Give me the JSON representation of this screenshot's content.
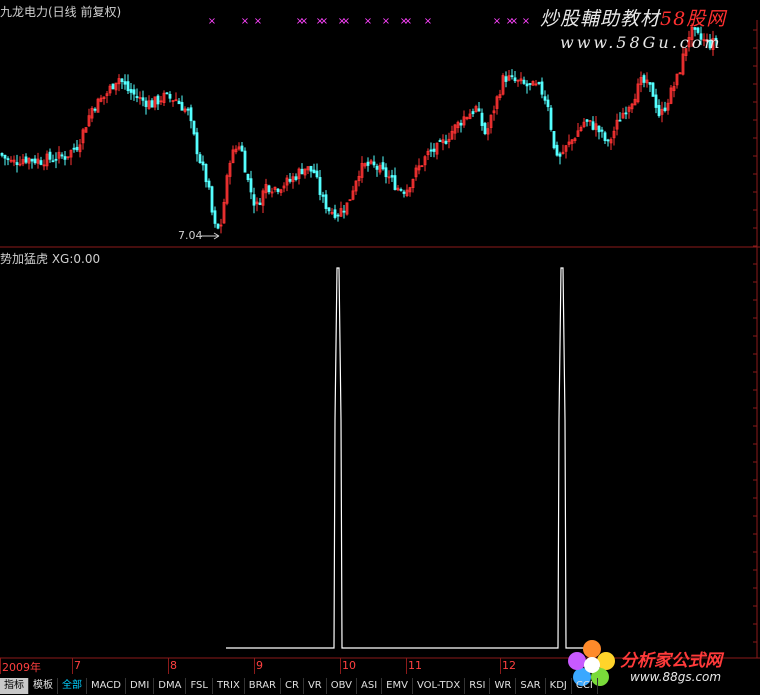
{
  "header": {
    "top_title": "九龙电力(日线 前复权)",
    "sub_title": "势加猛虎 XG:0.00",
    "low_label": "7.04"
  },
  "watermarks": {
    "line1_a": "炒股輔助教材",
    "line1_b": "58股网",
    "line2": "www.58Gu.com",
    "line3": "分析家公式网",
    "line4": "www.88gs.com"
  },
  "date_axis": [
    "2009年",
    "7",
    "8",
    "9",
    "10",
    "11",
    "12"
  ],
  "tabs": [
    {
      "label": "指标",
      "state": "selected"
    },
    {
      "label": "模板",
      "state": "normal"
    },
    {
      "label": "全部",
      "state": "active"
    },
    {
      "label": "MACD",
      "state": "normal"
    },
    {
      "label": "DMI",
      "state": "normal"
    },
    {
      "label": "DMA",
      "state": "normal"
    },
    {
      "label": "FSL",
      "state": "normal"
    },
    {
      "label": "TRIX",
      "state": "normal"
    },
    {
      "label": "BRAR",
      "state": "normal"
    },
    {
      "label": "CR",
      "state": "normal"
    },
    {
      "label": "VR",
      "state": "normal"
    },
    {
      "label": "OBV",
      "state": "normal"
    },
    {
      "label": "ASI",
      "state": "normal"
    },
    {
      "label": "EMV",
      "state": "normal"
    },
    {
      "label": "VOL-TDX",
      "state": "normal"
    },
    {
      "label": "RSI",
      "state": "normal"
    },
    {
      "label": "WR",
      "state": "normal"
    },
    {
      "label": "SAR",
      "state": "normal"
    },
    {
      "label": "KDJ",
      "state": "normal"
    },
    {
      "label": "CCI",
      "state": "normal"
    }
  ],
  "colors": {
    "up": "#ff3333",
    "down": "#54ffff",
    "signal_line": "#ffffff",
    "marker": "#ff44ff",
    "separator": "#8b1a1a",
    "axis_text": "#ff4040"
  },
  "chart_data": {
    "type": "candlestick",
    "title": "九龙电力(日线 前复权)",
    "annotations": [
      {
        "text": "7.04",
        "type": "period-low"
      }
    ],
    "price_path": [
      [
        0,
        8.9
      ],
      [
        12,
        8.7
      ],
      [
        24,
        8.8
      ],
      [
        40,
        8.75
      ],
      [
        52,
        8.8
      ],
      [
        66,
        8.85
      ],
      [
        78,
        9.1
      ],
      [
        92,
        9.9
      ],
      [
        106,
        10.2
      ],
      [
        118,
        10.6
      ],
      [
        128,
        10.3
      ],
      [
        140,
        10.1
      ],
      [
        152,
        10.0
      ],
      [
        164,
        10.15
      ],
      [
        176,
        10.1
      ],
      [
        188,
        9.8
      ],
      [
        198,
        8.9
      ],
      [
        208,
        8.2
      ],
      [
        214,
        7.3
      ],
      [
        220,
        7.2
      ],
      [
        230,
        8.8
      ],
      [
        240,
        9.15
      ],
      [
        248,
        8.3
      ],
      [
        256,
        7.7
      ],
      [
        266,
        8.2
      ],
      [
        276,
        8.15
      ],
      [
        290,
        8.3
      ],
      [
        304,
        8.6
      ],
      [
        314,
        8.5
      ],
      [
        322,
        7.9
      ],
      [
        330,
        7.65
      ],
      [
        338,
        7.6
      ],
      [
        348,
        7.8
      ],
      [
        358,
        8.5
      ],
      [
        366,
        8.65
      ],
      [
        376,
        8.6
      ],
      [
        388,
        8.4
      ],
      [
        398,
        8.15
      ],
      [
        406,
        8.1
      ],
      [
        416,
        8.5
      ],
      [
        428,
        8.9
      ],
      [
        440,
        9.05
      ],
      [
        452,
        9.4
      ],
      [
        464,
        9.7
      ],
      [
        476,
        9.9
      ],
      [
        486,
        9.3
      ],
      [
        494,
        9.9
      ],
      [
        504,
        10.6
      ],
      [
        514,
        10.5
      ],
      [
        526,
        10.4
      ],
      [
        540,
        10.35
      ],
      [
        548,
        10.0
      ],
      [
        554,
        9.0
      ],
      [
        560,
        8.85
      ],
      [
        572,
        9.2
      ],
      [
        584,
        9.6
      ],
      [
        596,
        9.5
      ],
      [
        608,
        9.1
      ],
      [
        620,
        9.7
      ],
      [
        632,
        10.1
      ],
      [
        642,
        10.5
      ],
      [
        652,
        10.3
      ],
      [
        660,
        9.7
      ],
      [
        668,
        10.1
      ],
      [
        678,
        10.6
      ],
      [
        690,
        11.6
      ],
      [
        702,
        11.4
      ],
      [
        712,
        11.3
      ],
      [
        718,
        11.5
      ]
    ],
    "price_range": [
      7.0,
      11.8
    ],
    "buy_markers_x": [
      212,
      245,
      258,
      300,
      304,
      320,
      324,
      342,
      346,
      368,
      386,
      404,
      408,
      428,
      497,
      510,
      514,
      526
    ],
    "indicator": {
      "name": "势加猛虎",
      "value_label": "XG:0.00",
      "ylim": [
        0,
        1
      ],
      "baseline": 0,
      "spikes": [
        {
          "x_start": 226,
          "x_end": 334,
          "value": 0
        },
        {
          "x_start": 334,
          "x_end": 342,
          "value": 1
        },
        {
          "x_start": 342,
          "x_end": 558,
          "value": 0
        },
        {
          "x_start": 558,
          "x_end": 566,
          "value": 1
        },
        {
          "x_start": 566,
          "x_end": 596,
          "value": 0
        }
      ]
    },
    "xaxis_labels": [
      "2009年",
      "7",
      "8",
      "9",
      "10",
      "11",
      "12"
    ]
  }
}
